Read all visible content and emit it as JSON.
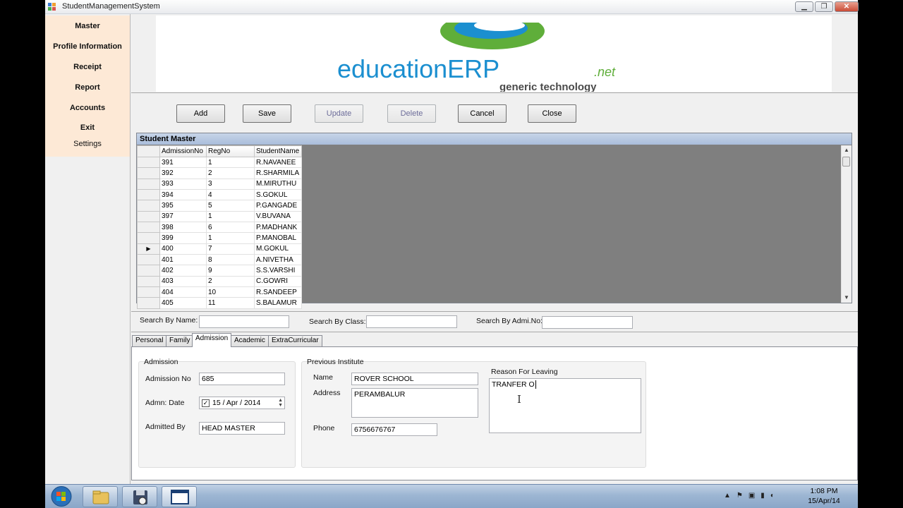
{
  "window": {
    "title": "StudentManagementSystem",
    "min": "▁",
    "max": "❐",
    "close": "✕"
  },
  "sidebar": {
    "items": [
      {
        "label": "Master"
      },
      {
        "label": "Profile Information"
      },
      {
        "label": "Receipt"
      },
      {
        "label": "Report"
      },
      {
        "label": "Accounts"
      },
      {
        "label": "Exit"
      },
      {
        "label": "Settings"
      }
    ]
  },
  "banner": {
    "brand": "educationERP",
    "brand_suffix": ".net",
    "tagline": "generic technology"
  },
  "toolbar": {
    "add": "Add",
    "save": "Save",
    "update": "Update",
    "delete": "Delete",
    "cancel": "Cancel",
    "close": "Close"
  },
  "grid": {
    "caption": "Student Master",
    "columns": [
      "AdmissionNo",
      "RegNo",
      "StudentName"
    ],
    "rows": [
      [
        "391",
        "1",
        "R.NAVANEE"
      ],
      [
        "392",
        "2",
        "R.SHARMILA"
      ],
      [
        "393",
        "3",
        "M.MIRUTHU"
      ],
      [
        "394",
        "4",
        "S.GOKUL"
      ],
      [
        "395",
        "5",
        "P.GANGADE"
      ],
      [
        "397",
        "1",
        "V.BUVANA"
      ],
      [
        "398",
        "6",
        "P.MADHANK"
      ],
      [
        "399",
        "1",
        "P.MANOBAL"
      ],
      [
        "400",
        "7",
        "M.GOKUL"
      ],
      [
        "401",
        "8",
        "A.NIVETHA"
      ],
      [
        "402",
        "9",
        "S.S.VARSHI"
      ],
      [
        "403",
        "2",
        "C.GOWRI"
      ],
      [
        "404",
        "10",
        "R.SANDEEP"
      ],
      [
        "405",
        "11",
        "S.BALAMUR"
      ]
    ],
    "current_row_marker": "▶"
  },
  "search": {
    "by_name": "Search By Name:",
    "by_class": "Search By Class:",
    "by_admno": "Search By Admi.No:"
  },
  "tabs": [
    "Personal",
    "Family",
    "Admission",
    "Academic",
    "ExtraCurricular"
  ],
  "admission": {
    "group_title": "Admission",
    "admission_no_label": "Admission No",
    "admission_no": "685",
    "admn_date_label": "Admn: Date",
    "admn_date": "15 / Apr / 2014",
    "admitted_by_label": "Admitted By",
    "admitted_by": "HEAD MASTER"
  },
  "previous": {
    "group_title": "Previous Institute",
    "name_label": "Name",
    "name": "ROVER SCHOOL",
    "address_label": "Address",
    "address": "PERAMBALUR",
    "phone_label": "Phone",
    "phone": "6756676767",
    "reason_label": "Reason For Leaving",
    "reason": "TRANFER O"
  },
  "taskbar": {
    "time": "1:08 PM",
    "date": "15/Apr/14"
  }
}
